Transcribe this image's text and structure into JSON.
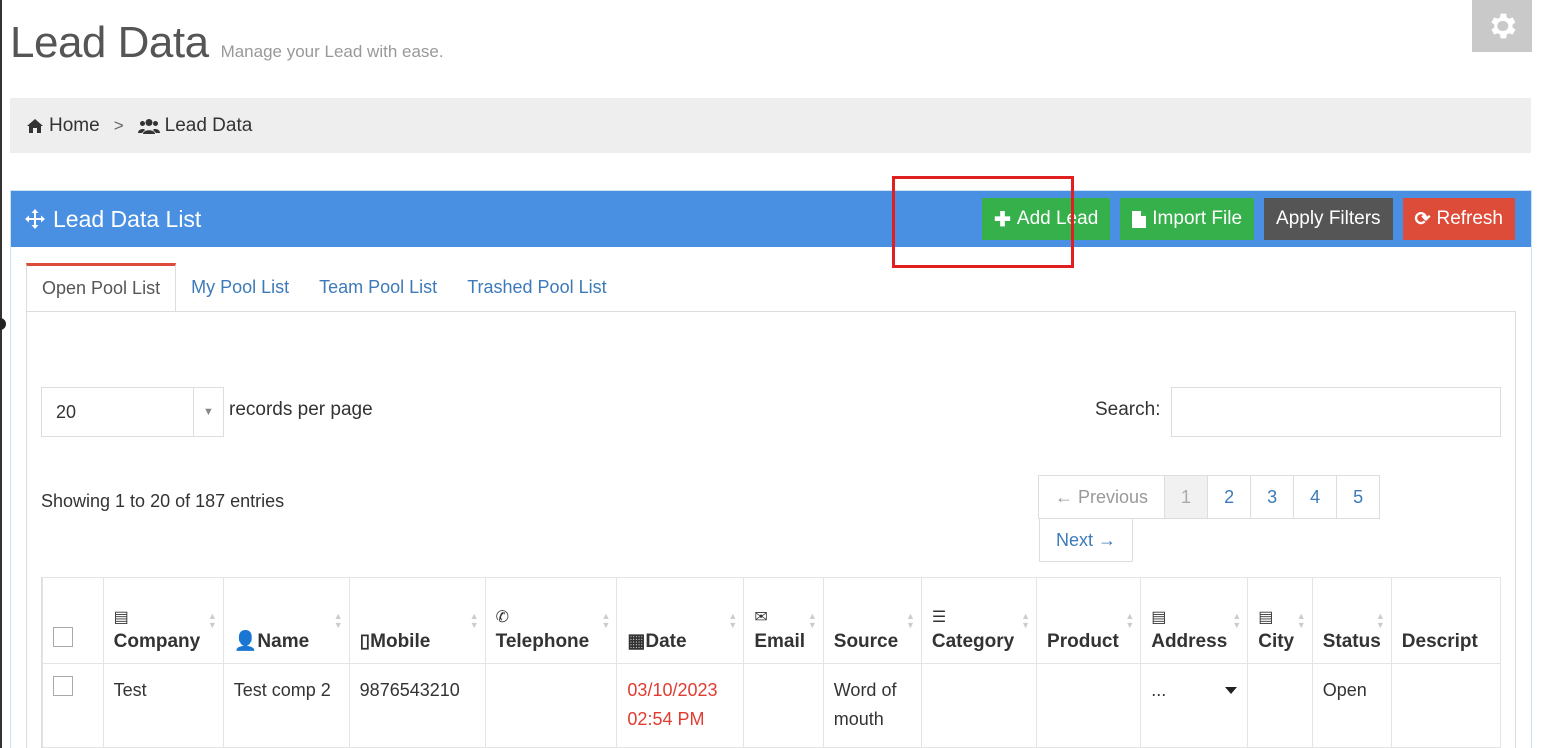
{
  "header": {
    "title": "Lead Data",
    "subtitle": "Manage your Lead with ease."
  },
  "breadcrumb": {
    "home": "Home",
    "separator": ">",
    "current": "Lead Data"
  },
  "panel": {
    "title": "Lead Data List",
    "buttons": {
      "add": "Add Lead",
      "import": "Import File",
      "filters": "Apply Filters",
      "refresh": "Refresh"
    }
  },
  "tabs": [
    "Open Pool List",
    "My Pool List",
    "Team Pool List",
    "Trashed Pool List"
  ],
  "length": {
    "value": "20",
    "label": "records per page"
  },
  "search": {
    "label": "Search:",
    "value": ""
  },
  "info": "Showing 1 to 20 of 187 entries",
  "pagination": {
    "previous": "← Previous",
    "pages": [
      "1",
      "2",
      "3",
      "4",
      "5"
    ],
    "next": "Next →",
    "current": "1"
  },
  "table": {
    "columns": [
      {
        "label": "Company",
        "icon": "building-icon"
      },
      {
        "label": "Name",
        "icon": "user-icon"
      },
      {
        "label": "Mobile",
        "icon": "mobile-icon"
      },
      {
        "label": "Telephone",
        "icon": "phone-icon"
      },
      {
        "label": "Date",
        "icon": "calendar-icon"
      },
      {
        "label": "Email",
        "icon": "envelope-icon"
      },
      {
        "label": "Source",
        "icon": ""
      },
      {
        "label": "Category",
        "icon": "list-icon"
      },
      {
        "label": "Product",
        "icon": ""
      },
      {
        "label": "Address",
        "icon": "building-icon"
      },
      {
        "label": "City",
        "icon": "building-icon"
      },
      {
        "label": "Status",
        "icon": ""
      },
      {
        "label": "Descript",
        "icon": ""
      }
    ],
    "rows": [
      {
        "company": "Test",
        "name": "Test comp 2",
        "mobile": "9876543210",
        "telephone": "",
        "date": "03/10/2023 02:54 PM",
        "email": "",
        "source": "Word of mouth",
        "category": "",
        "product": "",
        "address": "...",
        "city": "",
        "status": "Open",
        "description": ""
      }
    ]
  },
  "colors": {
    "panel_header": "#4a90e2",
    "green": "#35b04a",
    "dark": "#555555",
    "red": "#dd4b39",
    "link": "#3c7ab8",
    "date_text": "#e03c31"
  }
}
